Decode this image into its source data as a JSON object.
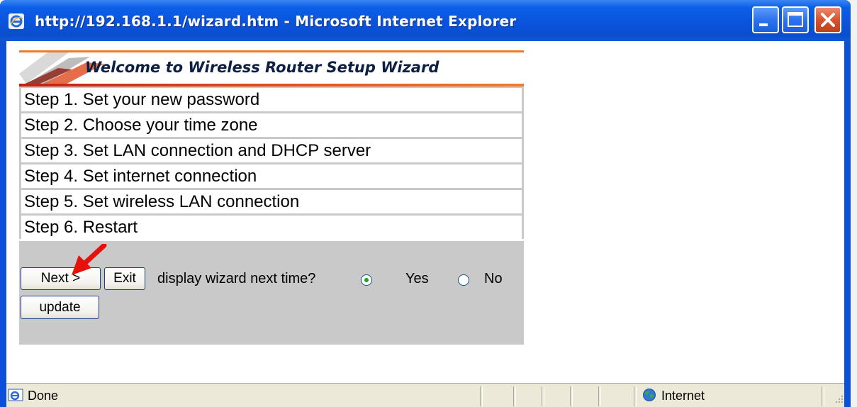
{
  "window": {
    "title": "http://192.168.1.1/wizard.htm - Microsoft Internet Explorer",
    "icon": "internet-explorer-icon",
    "controls": [
      "minimize-icon",
      "maximize-icon",
      "close-icon"
    ]
  },
  "wizard": {
    "title": "Welcome to Wireless Router Setup Wizard",
    "steps": [
      "Step 1. Set your new password",
      "Step 2. Choose your time zone",
      "Step 3. Set LAN connection and DHCP server",
      "Step 4. Set internet connection",
      "Step 5. Set wireless LAN connection",
      "Step 6. Restart"
    ],
    "next_label": "Next >",
    "exit_label": "Exit",
    "update_label": "update",
    "display_prompt": "display wizard next time?",
    "options": [
      {
        "label": "Yes",
        "selected": true
      },
      {
        "label": "No",
        "selected": false
      }
    ]
  },
  "statusbar": {
    "status": "Done",
    "zone": "Internet"
  },
  "colors": {
    "titlebar_blue": "#0a54dc",
    "banner_orange": "#ec7b2b",
    "panel_gray": "#c9c9c9",
    "statusbar_bg": "#ece9d8",
    "arrow_red": "#e8100c"
  }
}
